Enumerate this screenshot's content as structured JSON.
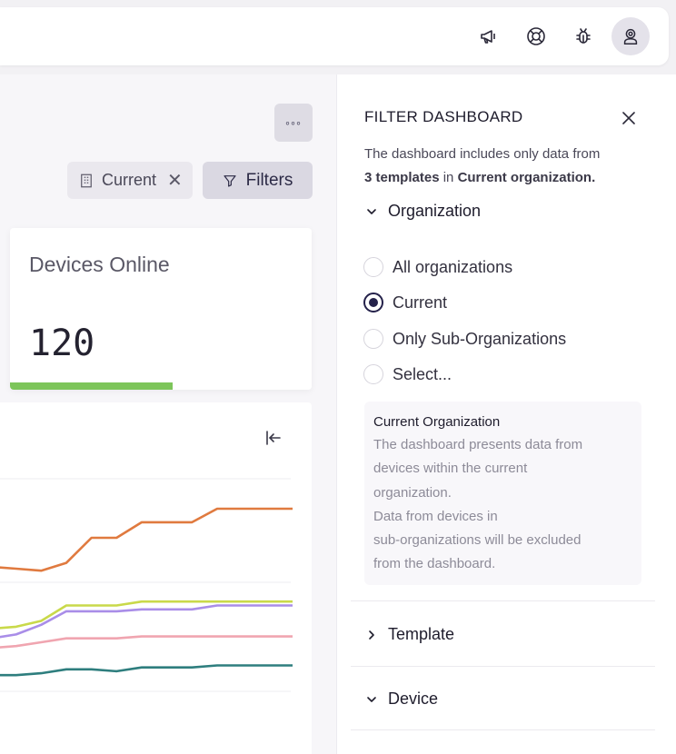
{
  "topbar": {
    "icons": [
      "megaphone-icon",
      "lifebuoy-icon",
      "bug-icon",
      "user-avatar-icon"
    ]
  },
  "toolbar": {
    "more_label": "◦◦◦",
    "current_chip_label": "Current",
    "current_chip_remove": "✕",
    "filters_label": "Filters"
  },
  "devices_card": {
    "title": "Devices Online",
    "value": "120",
    "progress": 0.54,
    "progress_color": "#7dc55a"
  },
  "chart_data": {
    "type": "line",
    "grid": true,
    "series": [
      {
        "color": "#e07a3f",
        "values": [
          70,
          69,
          68,
          72,
          85,
          85,
          93,
          93,
          93,
          100,
          100,
          100,
          100
        ]
      },
      {
        "color": "#c9d94a",
        "values": [
          38,
          39,
          42,
          50,
          50,
          50,
          52,
          52,
          52,
          52,
          52,
          52,
          52
        ]
      },
      {
        "color": "#a98de8",
        "values": [
          33,
          35,
          40,
          47,
          47,
          47,
          48,
          48,
          48,
          50,
          50,
          50,
          50
        ]
      },
      {
        "color": "#f0a5b0",
        "values": [
          28,
          29,
          31,
          33,
          33,
          33,
          34,
          34,
          34,
          34,
          34,
          34,
          34
        ]
      },
      {
        "color": "#2e7e7e",
        "values": [
          14,
          14,
          15,
          17,
          17,
          16,
          18,
          18,
          18,
          19,
          19,
          19,
          19
        ]
      }
    ]
  },
  "filter_panel": {
    "title": "FILTER DASHBOARD",
    "desc_prefix": "The dashboard includes only data from",
    "desc_count": "3 templates",
    "desc_in": " in ",
    "desc_org": "Current organization.",
    "organization": {
      "label": "Organization",
      "options": [
        {
          "label": "All organizations",
          "selected": false
        },
        {
          "label": "Current",
          "selected": true
        },
        {
          "label": "Only Sub-Organizations",
          "selected": false
        },
        {
          "label": "Select...",
          "selected": false
        }
      ],
      "info_title": "Current Organization",
      "info_lines": [
        "The dashboard presents data from",
        "devices within the current",
        "organization.",
        "Data from devices in",
        "sub-organizations will be excluded",
        "from the dashboard."
      ]
    },
    "template_label": "Template",
    "device_label": "Device"
  }
}
